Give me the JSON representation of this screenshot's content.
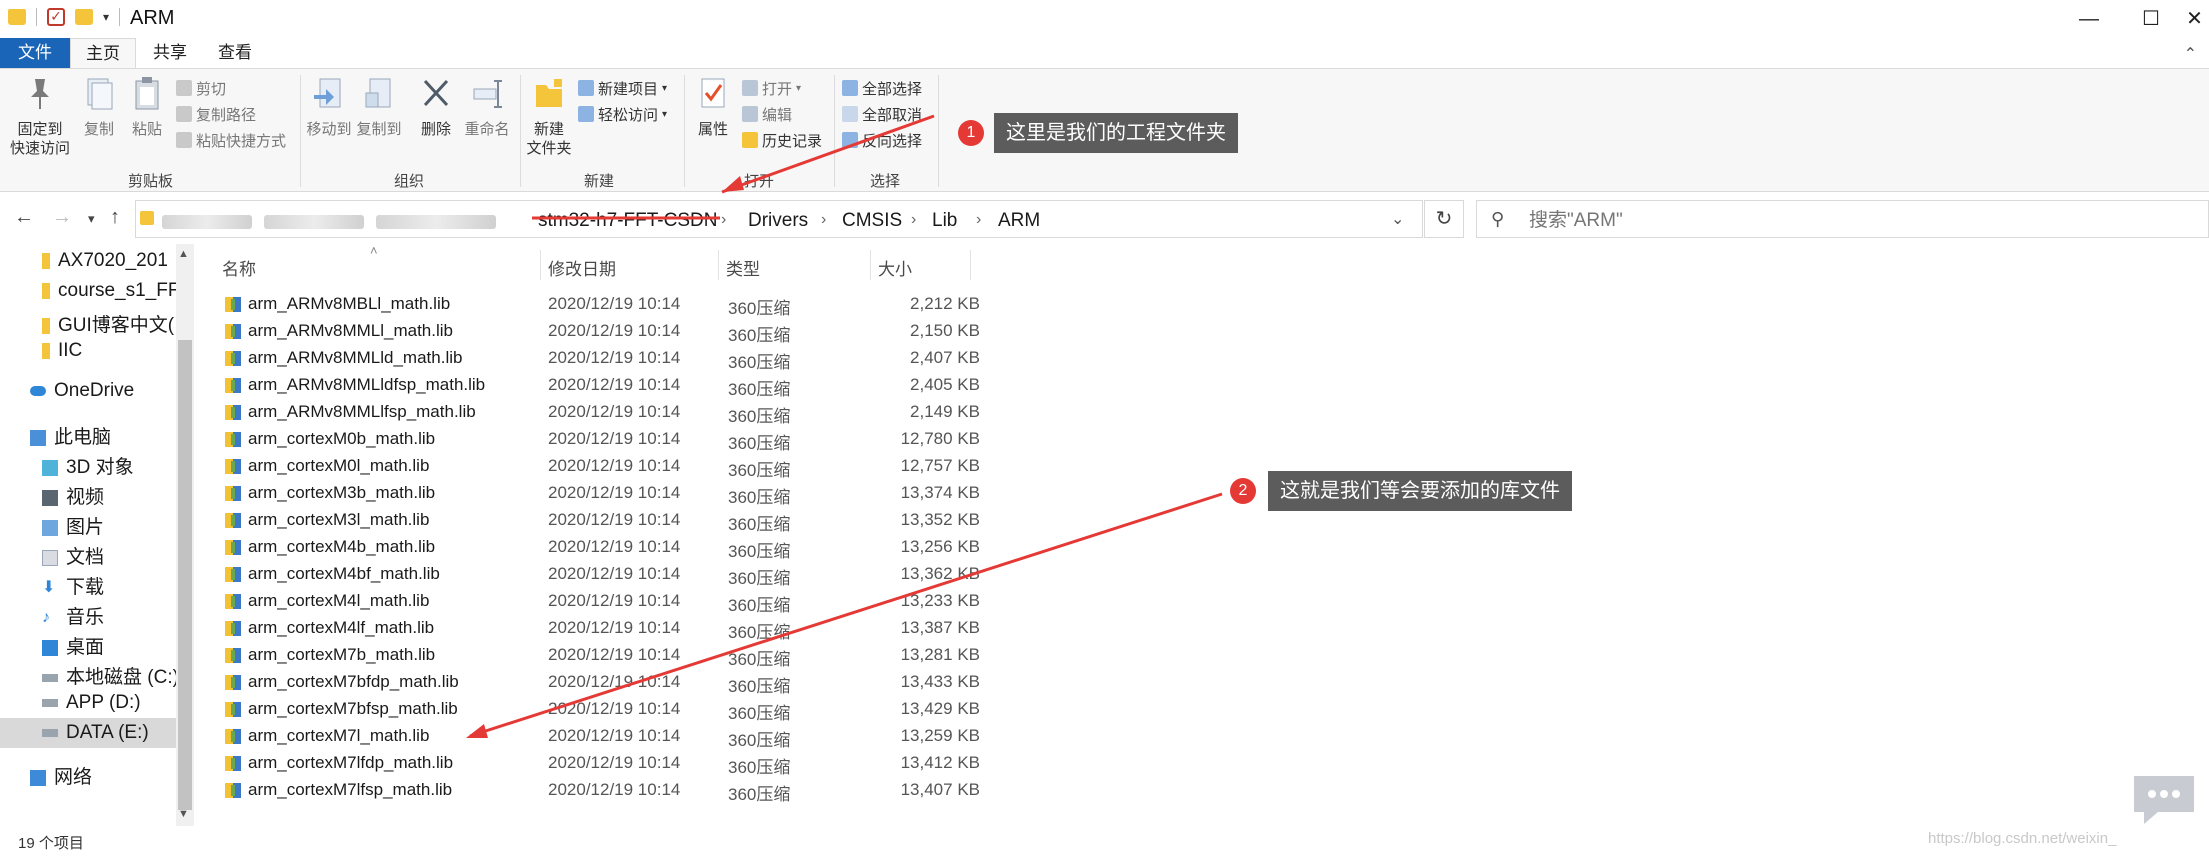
{
  "window": {
    "title": "ARM"
  },
  "window_controls": {
    "minimize": "—",
    "maximize": "☐",
    "close": "✕"
  },
  "menu_tabs": {
    "file": "文件",
    "home": "主页",
    "share": "共享",
    "view": "查看"
  },
  "ribbon": {
    "clipboard": {
      "label": "剪贴板",
      "pin": "固定到\n快速访问",
      "pin_1": "固定到",
      "pin_2": "快速访问",
      "copy": "复制",
      "paste": "粘贴",
      "cut": "剪切",
      "copy_path": "复制路径",
      "paste_shortcut": "粘贴快捷方式"
    },
    "organize": {
      "label": "组织",
      "move_to": "移动到",
      "copy_to": "复制到",
      "delete": "删除",
      "rename": "重命名"
    },
    "new": {
      "label": "新建",
      "new_folder_1": "新建",
      "new_folder_2": "文件夹",
      "new_item": "新建项目",
      "easy_access": "轻松访问"
    },
    "open": {
      "label": "打开",
      "properties": "属性",
      "open": "打开",
      "edit": "编辑",
      "history": "历史记录"
    },
    "select": {
      "label": "选择",
      "select_all": "全部选择",
      "select_none": "全部取消",
      "invert": "反向选择"
    }
  },
  "address": {
    "crumbs": [
      "stm32-h7-FFT-CSDN",
      "Drivers",
      "CMSIS",
      "Lib",
      "ARM"
    ]
  },
  "search": {
    "placeholder": "搜索\"ARM\""
  },
  "sidebar": {
    "items": [
      "AX7020_201",
      "course_s1_FF",
      "GUI博客中文(",
      "IIC",
      "OneDrive",
      "此电脑",
      "3D 对象",
      "视频",
      "图片",
      "文档",
      "下载",
      "音乐",
      "桌面",
      "本地磁盘 (C:)",
      "APP (D:)",
      "DATA (E:)",
      "网络"
    ]
  },
  "columns": {
    "name": "名称",
    "date": "修改日期",
    "type": "类型",
    "size": "大小"
  },
  "files": [
    {
      "name": "arm_ARMv8MBLl_math.lib",
      "date": "2020/12/19 10:14",
      "type": "360压缩",
      "size": "2,212 KB"
    },
    {
      "name": "arm_ARMv8MMLl_math.lib",
      "date": "2020/12/19 10:14",
      "type": "360压缩",
      "size": "2,150 KB"
    },
    {
      "name": "arm_ARMv8MMLld_math.lib",
      "date": "2020/12/19 10:14",
      "type": "360压缩",
      "size": "2,407 KB"
    },
    {
      "name": "arm_ARMv8MMLldfsp_math.lib",
      "date": "2020/12/19 10:14",
      "type": "360压缩",
      "size": "2,405 KB"
    },
    {
      "name": "arm_ARMv8MMLlfsp_math.lib",
      "date": "2020/12/19 10:14",
      "type": "360压缩",
      "size": "2,149 KB"
    },
    {
      "name": "arm_cortexM0b_math.lib",
      "date": "2020/12/19 10:14",
      "type": "360压缩",
      "size": "12,780 KB"
    },
    {
      "name": "arm_cortexM0l_math.lib",
      "date": "2020/12/19 10:14",
      "type": "360压缩",
      "size": "12,757 KB"
    },
    {
      "name": "arm_cortexM3b_math.lib",
      "date": "2020/12/19 10:14",
      "type": "360压缩",
      "size": "13,374 KB"
    },
    {
      "name": "arm_cortexM3l_math.lib",
      "date": "2020/12/19 10:14",
      "type": "360压缩",
      "size": "13,352 KB"
    },
    {
      "name": "arm_cortexM4b_math.lib",
      "date": "2020/12/19 10:14",
      "type": "360压缩",
      "size": "13,256 KB"
    },
    {
      "name": "arm_cortexM4bf_math.lib",
      "date": "2020/12/19 10:14",
      "type": "360压缩",
      "size": "13,362 KB"
    },
    {
      "name": "arm_cortexM4l_math.lib",
      "date": "2020/12/19 10:14",
      "type": "360压缩",
      "size": "13,233 KB"
    },
    {
      "name": "arm_cortexM4lf_math.lib",
      "date": "2020/12/19 10:14",
      "type": "360压缩",
      "size": "13,387 KB"
    },
    {
      "name": "arm_cortexM7b_math.lib",
      "date": "2020/12/19 10:14",
      "type": "360压缩",
      "size": "13,281 KB"
    },
    {
      "name": "arm_cortexM7bfdp_math.lib",
      "date": "2020/12/19 10:14",
      "type": "360压缩",
      "size": "13,433 KB"
    },
    {
      "name": "arm_cortexM7bfsp_math.lib",
      "date": "2020/12/19 10:14",
      "type": "360压缩",
      "size": "13,429 KB"
    },
    {
      "name": "arm_cortexM7l_math.lib",
      "date": "2020/12/19 10:14",
      "type": "360压缩",
      "size": "13,259 KB"
    },
    {
      "name": "arm_cortexM7lfdp_math.lib",
      "date": "2020/12/19 10:14",
      "type": "360压缩",
      "size": "13,412 KB"
    },
    {
      "name": "arm_cortexM7lfsp_math.lib",
      "date": "2020/12/19 10:14",
      "type": "360压缩",
      "size": "13,407 KB"
    }
  ],
  "status": {
    "count": "19 个项目"
  },
  "annotations": {
    "note1": {
      "num": "1",
      "text": "这里是我们的工程文件夹"
    },
    "note2": {
      "num": "2",
      "text": "这就是我们等会要添加的库文件"
    }
  },
  "watermark": "https://blog.csdn.net/weixin_",
  "colors": {
    "accent": "#1a65b8",
    "annotation_red": "#e53935",
    "callout_bg": "#5c5c5c"
  }
}
